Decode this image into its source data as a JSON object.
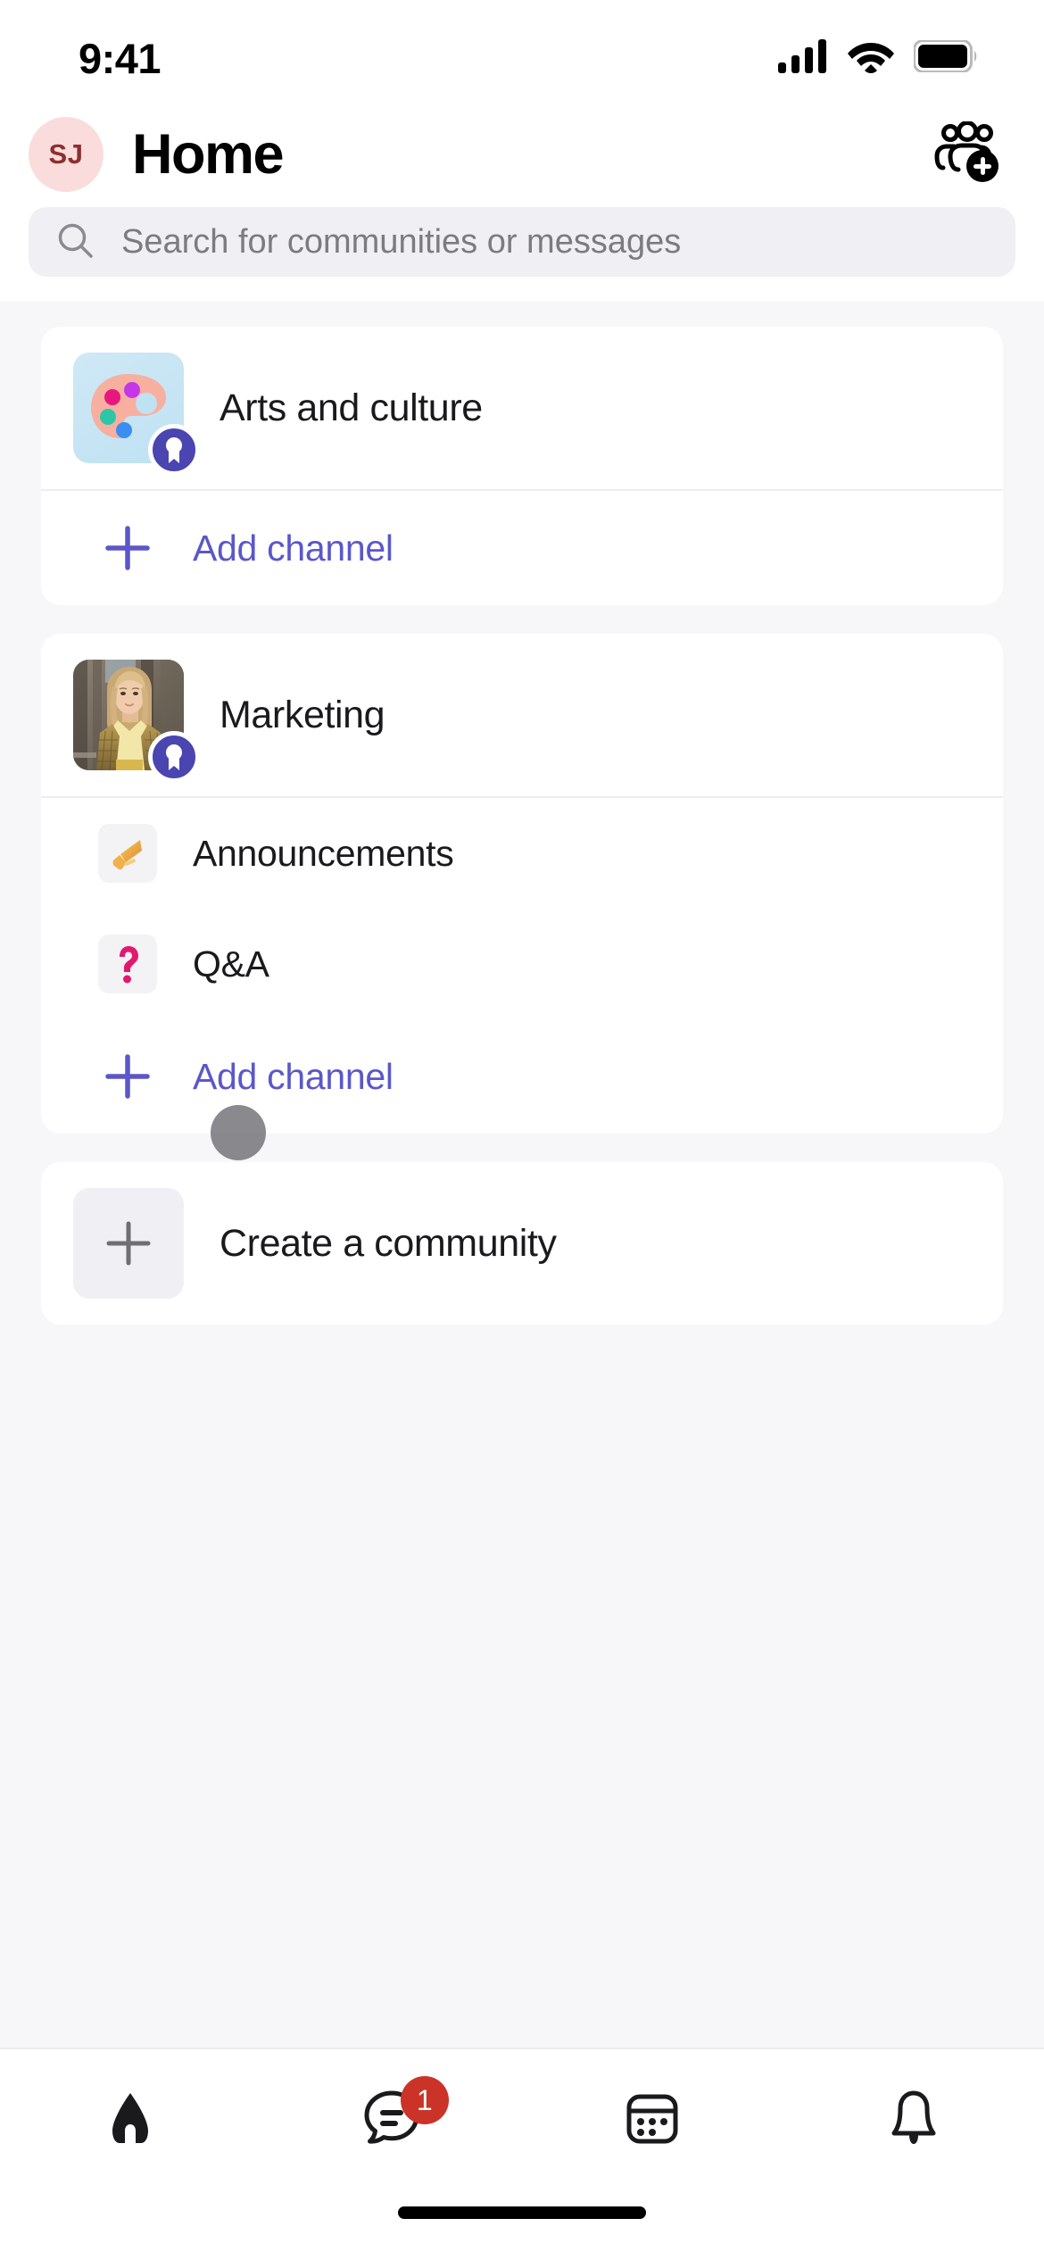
{
  "status_bar": {
    "time": "9:41",
    "cellular_icon": "signal-bars-icon",
    "wifi_icon": "wifi-icon",
    "battery_icon": "battery-full-icon"
  },
  "header": {
    "avatar_initials": "SJ",
    "avatar_bg": "#fadcdc",
    "avatar_fg": "#8c2f2f",
    "title": "Home",
    "action_icon": "add-people-icon"
  },
  "search": {
    "placeholder": "Search for communities or messages",
    "icon": "search-icon"
  },
  "theme": {
    "accent": "#5b57c9",
    "badge_red": "#cc3328",
    "page_bg": "#f7f6f9",
    "card_bg": "#ffffff"
  },
  "communities": [
    {
      "name": "Arts and culture",
      "avatar_type": "palette-illustration",
      "owner_badge": "owner-medal-icon",
      "channels": [],
      "add_channel": {
        "label": "Add channel",
        "icon": "plus-icon"
      }
    },
    {
      "name": "Marketing",
      "avatar_type": "photo-portrait",
      "owner_badge": "owner-medal-icon",
      "channels": [
        {
          "name": "Announcements",
          "icon": "megaphone-emoji",
          "glyph": "📣"
        },
        {
          "name": "Q&A",
          "icon": "question-mark-emoji",
          "glyph": "❓"
        }
      ],
      "add_channel": {
        "label": "Add channel",
        "icon": "plus-icon"
      }
    }
  ],
  "create_community": {
    "label": "Create a community",
    "icon": "plus-icon"
  },
  "tab_bar": {
    "tabs": [
      {
        "name": "home",
        "icon": "home-icon",
        "active": true,
        "badge": ""
      },
      {
        "name": "chat",
        "icon": "chat-bubble-icon",
        "active": false,
        "badge": "1"
      },
      {
        "name": "calendar",
        "icon": "calendar-icon",
        "active": false,
        "badge": ""
      },
      {
        "name": "activity",
        "icon": "bell-icon",
        "active": false,
        "badge": ""
      }
    ]
  }
}
